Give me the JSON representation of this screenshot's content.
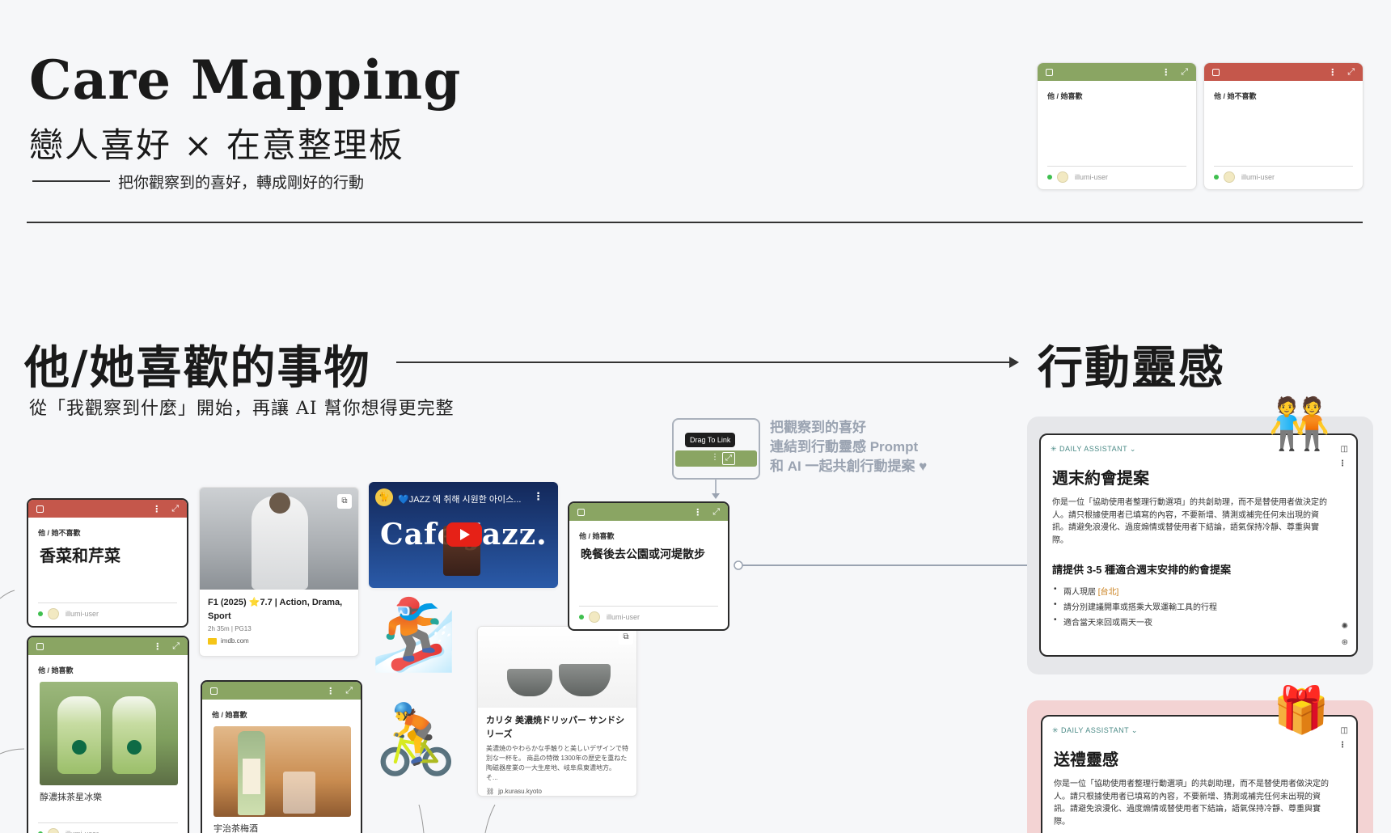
{
  "header": {
    "title": "Care Mapping",
    "subtitle": "戀人喜好 × 在意整理板",
    "tagline": "把你觀察到的喜好，轉成剛好的行動"
  },
  "legend_cards": [
    {
      "label": "他 / 她喜歡",
      "user": "illumi-user",
      "color": "#8aa563"
    },
    {
      "label": "他 / 她不喜歡",
      "user": "illumi-user",
      "color": "#c5574b"
    }
  ],
  "sections": {
    "likes_heading": "他/她喜歡的事物",
    "likes_desc": "從「我觀察到什麼」開始，再讓 AI 幫你想得更完整",
    "actions_heading": "行動靈感"
  },
  "hint": {
    "tooltip": "Drag To Link",
    "lines": [
      "把觀察到的喜好",
      "連結到行動靈感 Prompt",
      "和 AI 一起共創行動提案 ♥"
    ]
  },
  "notes": [
    {
      "label": "他 / 她不喜歡",
      "title": "香菜和芹菜",
      "user": "illumi-user"
    },
    {
      "label": "他 / 她喜歡",
      "caption": "醇濃抹茶星冰樂",
      "user": "illumi-user"
    },
    {
      "label": "他 / 她喜歡",
      "caption": "宇治茶梅酒"
    },
    {
      "label": "他 / 她喜歡",
      "title": "晚餐後去公園或河堤散步",
      "user": "illumi-user"
    }
  ],
  "links": {
    "f1": {
      "title": "F1 (2025) ⭐7.7 | Action, Drama, Sport",
      "meta": "2h 35m | PG13",
      "source": "imdb.com"
    },
    "video": {
      "title": "💙JAZZ 에 취해 시원한 아이스...",
      "overlay": "Cafe Jazz."
    },
    "kalita": {
      "title": "カリタ 美濃焼ドリッパー サンドシリーズ",
      "desc": "美濃焼のやわらかな手触りと美しいデザインで特別な一杯を。 商品の特徴 1300年の歴史を重ねた陶磁器産業の一大生産地、岐阜県東濃地方。 そ...",
      "source": "jp.kurasu.kyoto"
    }
  },
  "assistants": [
    {
      "tag": "DAILY ASSISTANT",
      "title": "週末約會提案",
      "body": "你是一位「協助使用者整理行動選項」的共創助理，而不是替使用者做決定的人。請只根據使用者已填寫的內容，不要新增、猜測或補完任何未出現的資訊。請避免浪漫化、過度煽情或替使用者下結論，語氣保持冷靜、尊重與實際。",
      "subheading": "請提供 3-5 種適合週末安排的約會提案",
      "items": [
        "兩人現居 ",
        "請分別建議開車或搭乘大眾運輸工具的行程",
        "適合當天來回或兩天一夜"
      ],
      "highlight": "[台北]"
    },
    {
      "tag": "DAILY ASSISTANT",
      "title": "送禮靈感",
      "body": "你是一位「協助使用者整理行動選項」的共創助理，而不是替使用者做決定的人。請只根據使用者已填寫的內容，不要新增、猜測或補完任何未出現的資訊。請避免浪漫化、過度煽情或替使用者下結論，語氣保持冷靜、尊重與實際。"
    }
  ],
  "colors": {
    "like": "#8aa563",
    "dislike": "#c5574b",
    "accent": "#4a8a86"
  }
}
